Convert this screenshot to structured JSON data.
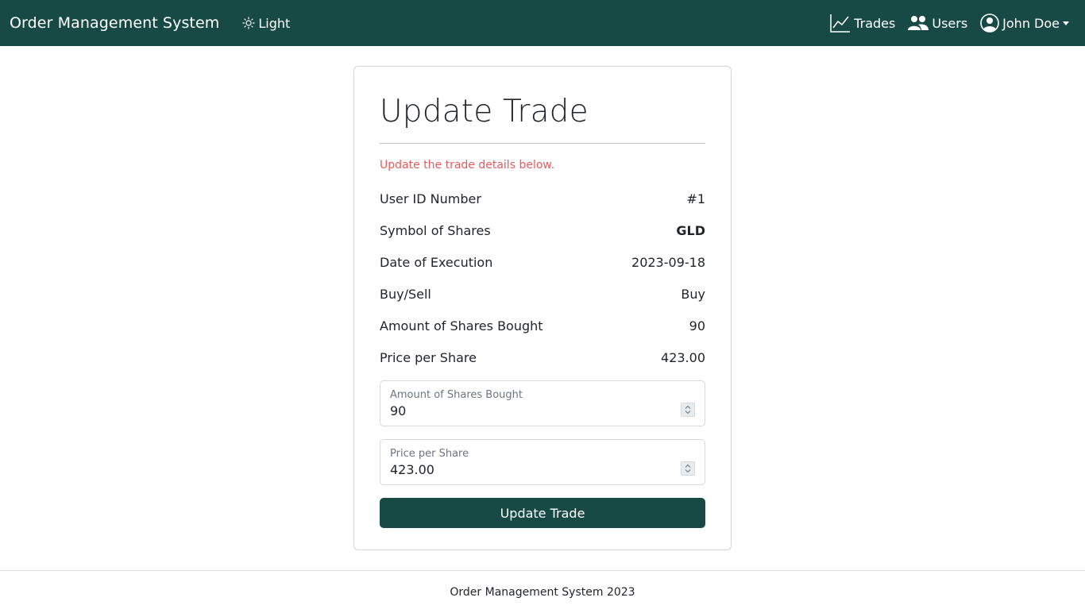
{
  "navbar": {
    "brand": "Order Management System",
    "theme_label": "Light",
    "links": {
      "trades": "Trades",
      "users": "Users",
      "account": "John Doe"
    }
  },
  "card": {
    "title": "Update Trade",
    "subtitle": "Update the trade details below.",
    "details": [
      {
        "label": "User ID Number",
        "value": "#1"
      },
      {
        "label": "Symbol of Shares",
        "value": "GLD"
      },
      {
        "label": "Date of Execution",
        "value": "2023-09-18"
      },
      {
        "label": "Buy/Sell",
        "value": "Buy"
      },
      {
        "label": "Amount of Shares Bought",
        "value": "90"
      },
      {
        "label": "Price per Share",
        "value": "423.00"
      }
    ],
    "form": {
      "amount": {
        "label": "Amount of Shares Bought",
        "value": "90"
      },
      "price": {
        "label": "Price per Share",
        "value": "423.00"
      },
      "submit_label": "Update Trade"
    }
  },
  "footer": {
    "text": "Order Management System 2023"
  },
  "colors": {
    "primary": "#184a45",
    "subtitle": "#e35d5d"
  }
}
